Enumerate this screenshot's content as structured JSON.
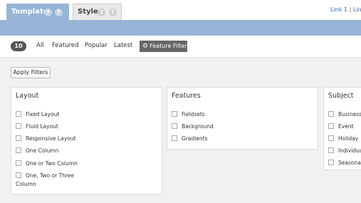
{
  "tabs": [
    {
      "label": "Template",
      "help1": "?",
      "help2": "?"
    },
    {
      "label": "Style",
      "help1": "?",
      "help2": "?"
    }
  ],
  "links": {
    "link1": "Link 1",
    "separator": "|",
    "link2": "Link"
  },
  "filter_bar": {
    "count": "10",
    "links": [
      "All",
      "Featured",
      "Popular",
      "Latest"
    ],
    "feature_filter": "Feature Filter"
  },
  "apply_button": "Apply Filters",
  "groups": [
    {
      "title": "Layout",
      "options": [
        "Fixed Layout",
        "Fluid Layout",
        "Responsive Layout",
        "One Column",
        "One or Two Column",
        "One, Two or Three",
        "Column"
      ]
    },
    {
      "title": "Features",
      "options": [
        "Fieldsets",
        "Background",
        "Gradients"
      ]
    },
    {
      "title": "Subject",
      "options": [
        "Business",
        "Event",
        "Holiday",
        "Individual",
        "Seasonal"
      ]
    }
  ],
  "colors": {
    "accent": "#97b4d6",
    "button_dark": "#666666",
    "link": "#2a6aa8"
  }
}
